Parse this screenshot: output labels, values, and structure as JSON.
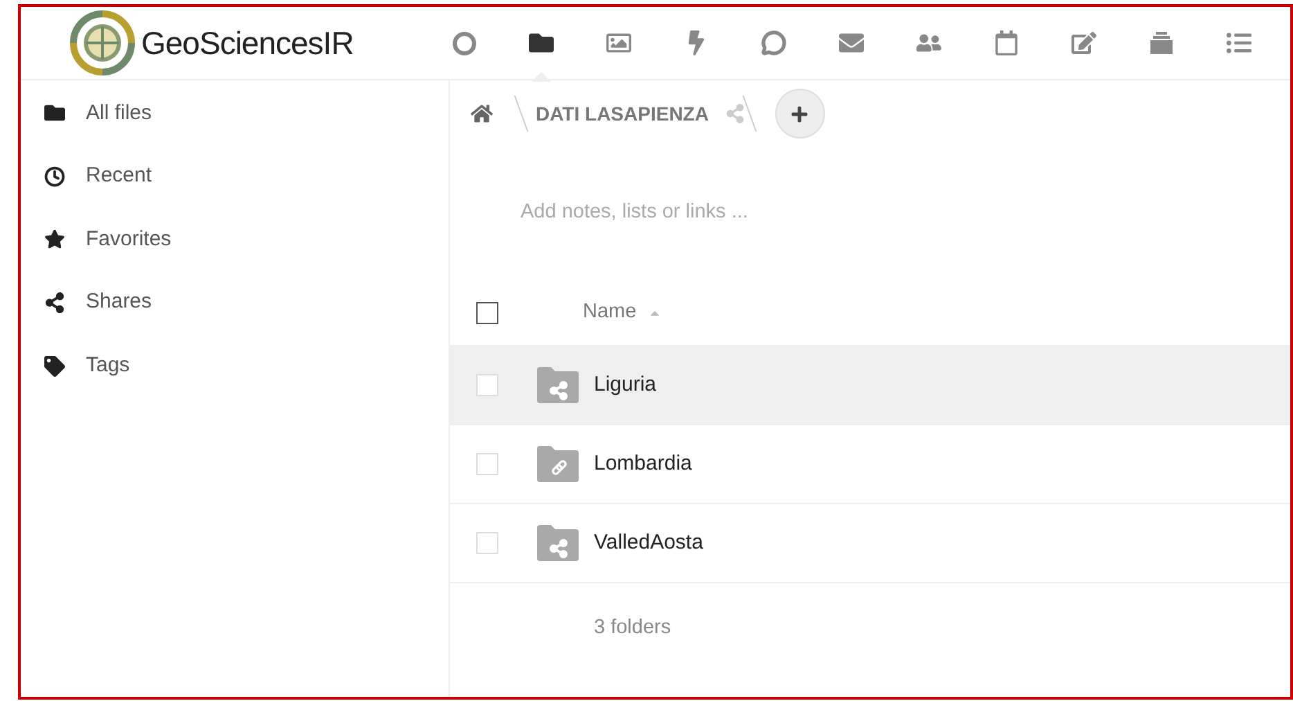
{
  "header": {
    "logo_text": "GeoSciencesIR",
    "apps": [
      {
        "kind": "circle",
        "selected": false
      },
      {
        "kind": "folder",
        "selected": true
      },
      {
        "kind": "image",
        "selected": false
      },
      {
        "kind": "bolt",
        "selected": false
      },
      {
        "kind": "chat",
        "selected": false
      },
      {
        "kind": "mail",
        "selected": false
      },
      {
        "kind": "contacts",
        "selected": false
      },
      {
        "kind": "calendar",
        "selected": false
      },
      {
        "kind": "notes",
        "selected": false
      },
      {
        "kind": "deck",
        "selected": false
      },
      {
        "kind": "tasks",
        "selected": false
      }
    ]
  },
  "sidebar": {
    "items": [
      {
        "kind": "folder",
        "label": "All files"
      },
      {
        "kind": "clock",
        "label": "Recent"
      },
      {
        "kind": "star",
        "label": "Favorites"
      },
      {
        "kind": "share",
        "label": "Shares"
      },
      {
        "kind": "tag",
        "label": "Tags"
      }
    ]
  },
  "breadcrumb": {
    "folder": "DATI LASAPIENZA",
    "shared": true
  },
  "notes": {
    "placeholder": "Add notes, lists or links ..."
  },
  "table": {
    "header": {
      "name": "Name",
      "sort_ascending": true,
      "checked": false
    },
    "rows": [
      {
        "name": "Liguria",
        "kind": "shared",
        "checked": false,
        "selected": true
      },
      {
        "name": "Lombardia",
        "kind": "link",
        "checked": false,
        "selected": false
      },
      {
        "name": "ValledAosta",
        "kind": "shared",
        "checked": false,
        "selected": false
      }
    ],
    "summary": "3 folders"
  }
}
